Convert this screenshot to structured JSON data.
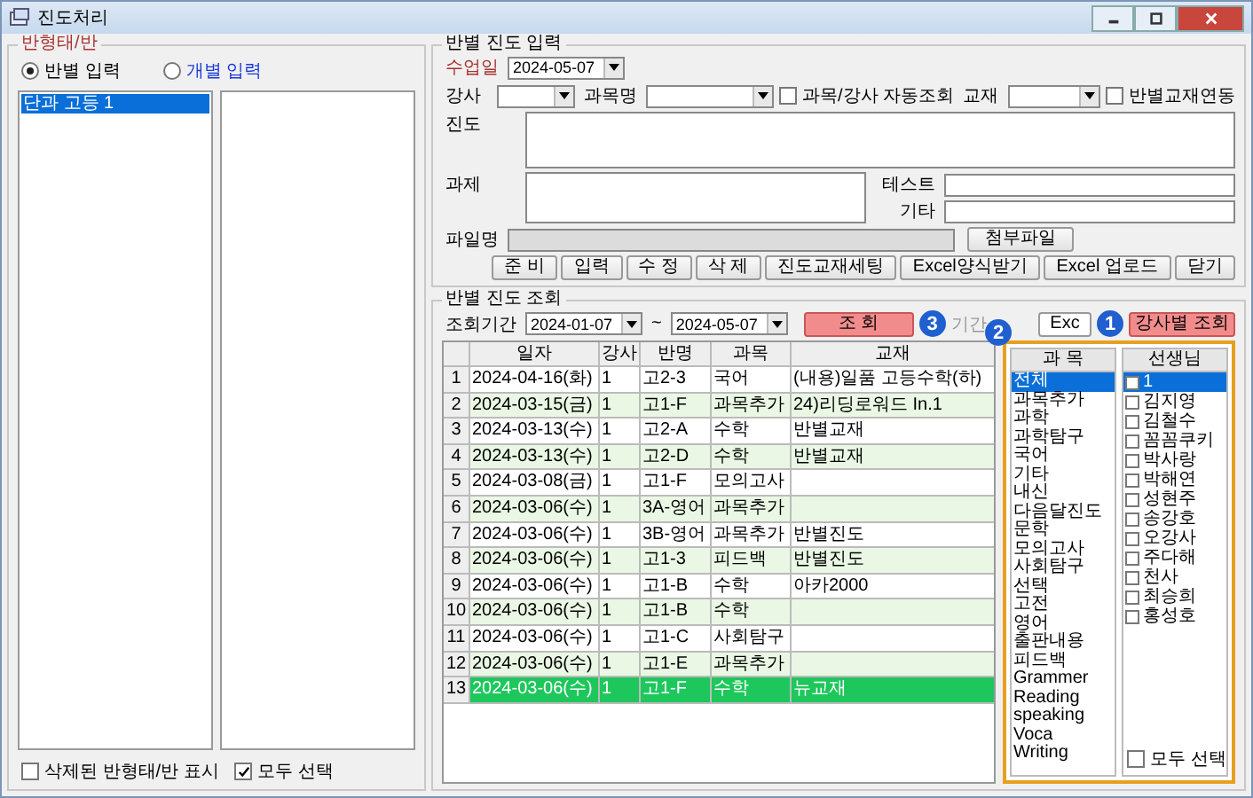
{
  "window": {
    "title": "진도처리"
  },
  "class_panel": {
    "legend": "반형태/반",
    "modes": [
      {
        "label": "반별 입력",
        "selected": true
      },
      {
        "label": "개별 입력",
        "selected": false
      }
    ],
    "classes": [
      {
        "label": "단과 고등 1",
        "selected": true
      }
    ],
    "show_deleted": {
      "label": "삭제된 반형태/반 표시",
      "checked": false
    },
    "select_all": {
      "label": "모두 선택",
      "checked": true
    }
  },
  "entry": {
    "legend": "반별 진도 입력",
    "date_label": "수업일",
    "date": "2024-05-07",
    "teacher_label": "강사",
    "subject_label": "과목명",
    "auto_lookup": {
      "label": "과목/강사 자동조회",
      "checked": false
    },
    "book_label": "교재",
    "book_link": {
      "label": "반별교재연동",
      "checked": false
    },
    "progress_label": "진도",
    "homework_label": "과제",
    "test_label": "테스트",
    "etc_label": "기타",
    "file_label": "파일명",
    "attach_button": "첨부파일",
    "buttons": [
      "준 비",
      "입력",
      "수 정",
      "삭 제",
      "진도교재세팅",
      "Excel양식받기",
      "Excel 업로드",
      "닫기"
    ]
  },
  "lookup": {
    "legend": "반별 진도 조회",
    "period_label": "조회기간",
    "from": "2024-01-07",
    "separator": "~",
    "to": "2024-05-07",
    "search_button": "조 회",
    "search_callout": "3",
    "faded_label": "기간",
    "excel_button": "Exc",
    "teacher_button": "강사별 조회",
    "teacher_callout": "1",
    "table": {
      "columns": [
        "일자",
        "강사",
        "반명",
        "과목",
        "교재"
      ],
      "rows": [
        {
          "no": "1",
          "cells": [
            "2024-04-16(화)",
            "1",
            "고2-3",
            "국어",
            "(내용)일품 고등수학(하)"
          ],
          "selected": false
        },
        {
          "no": "2",
          "cells": [
            "2024-03-15(금)",
            "1",
            "고1-F",
            "과목추가",
            "24)리딩로워드 In.1"
          ],
          "selected": false
        },
        {
          "no": "3",
          "cells": [
            "2024-03-13(수)",
            "1",
            "고2-A",
            "수학",
            "반별교재"
          ],
          "selected": false
        },
        {
          "no": "4",
          "cells": [
            "2024-03-13(수)",
            "1",
            "고2-D",
            "수학",
            "반별교재"
          ],
          "selected": false
        },
        {
          "no": "5",
          "cells": [
            "2024-03-08(금)",
            "1",
            "고1-F",
            "모의고사",
            ""
          ],
          "selected": false
        },
        {
          "no": "6",
          "cells": [
            "2024-03-06(수)",
            "1",
            "3A-영어",
            "과목추가",
            ""
          ],
          "selected": false
        },
        {
          "no": "7",
          "cells": [
            "2024-03-06(수)",
            "1",
            "3B-영어",
            "과목추가",
            "반별진도"
          ],
          "selected": false
        },
        {
          "no": "8",
          "cells": [
            "2024-03-06(수)",
            "1",
            "고1-3",
            "피드백",
            "반별진도"
          ],
          "selected": false
        },
        {
          "no": "9",
          "cells": [
            "2024-03-06(수)",
            "1",
            "고1-B",
            "수학",
            "아카2000"
          ],
          "selected": false
        },
        {
          "no": "10",
          "cells": [
            "2024-03-06(수)",
            "1",
            "고1-B",
            "수학",
            ""
          ],
          "selected": false
        },
        {
          "no": "11",
          "cells": [
            "2024-03-06(수)",
            "1",
            "고1-C",
            "사회탐구",
            ""
          ],
          "selected": false
        },
        {
          "no": "12",
          "cells": [
            "2024-03-06(수)",
            "1",
            "고1-E",
            "과목추가",
            ""
          ],
          "selected": false
        },
        {
          "no": "13",
          "cells": [
            "2024-03-06(수)",
            "1",
            "고1-F",
            "수학",
            "뉴교재"
          ],
          "selected": true
        }
      ]
    },
    "subjects": {
      "header": "과 목",
      "callout": "2",
      "items": [
        {
          "label": "전체",
          "selected": true
        },
        {
          "label": "과목추가",
          "selected": false
        },
        {
          "label": "과학",
          "selected": false
        },
        {
          "label": "과학탐구",
          "selected": false
        },
        {
          "label": "국어",
          "selected": false
        },
        {
          "label": "기타",
          "selected": false
        },
        {
          "label": "내신",
          "selected": false
        },
        {
          "label": "다음달진도",
          "selected": false
        },
        {
          "label": "문학",
          "selected": false
        },
        {
          "label": "모의고사",
          "selected": false
        },
        {
          "label": "사회탐구",
          "selected": false
        },
        {
          "label": "선택",
          "selected": false
        },
        {
          "label": "고전",
          "selected": false
        },
        {
          "label": "영어",
          "selected": false
        },
        {
          "label": "출판내용",
          "selected": false
        },
        {
          "label": "피드백",
          "selected": false
        },
        {
          "label": "Grammer",
          "selected": false
        },
        {
          "label": "Reading",
          "selected": false
        },
        {
          "label": "speaking",
          "selected": false
        },
        {
          "label": "Voca",
          "selected": false
        },
        {
          "label": "Writing",
          "selected": false
        }
      ]
    },
    "teachers": {
      "header": "선생님",
      "items": [
        {
          "label": "1",
          "checked": false,
          "selected": true
        },
        {
          "label": "김지영",
          "checked": false,
          "selected": false
        },
        {
          "label": "김철수",
          "checked": false,
          "selected": false
        },
        {
          "label": "꼼꼼쿠키",
          "checked": false,
          "selected": false
        },
        {
          "label": "박사랑",
          "checked": false,
          "selected": false
        },
        {
          "label": "박해연",
          "checked": false,
          "selected": false
        },
        {
          "label": "성현주",
          "checked": false,
          "selected": false
        },
        {
          "label": "송강호",
          "checked": false,
          "selected": false
        },
        {
          "label": "오강사",
          "checked": false,
          "selected": false
        },
        {
          "label": "주다해",
          "checked": false,
          "selected": false
        },
        {
          "label": "천사",
          "checked": false,
          "selected": false
        },
        {
          "label": "최승희",
          "checked": false,
          "selected": false
        },
        {
          "label": "홍성호",
          "checked": false,
          "selected": false
        }
      ],
      "select_all": {
        "label": "모두 선택",
        "checked": false
      }
    }
  }
}
